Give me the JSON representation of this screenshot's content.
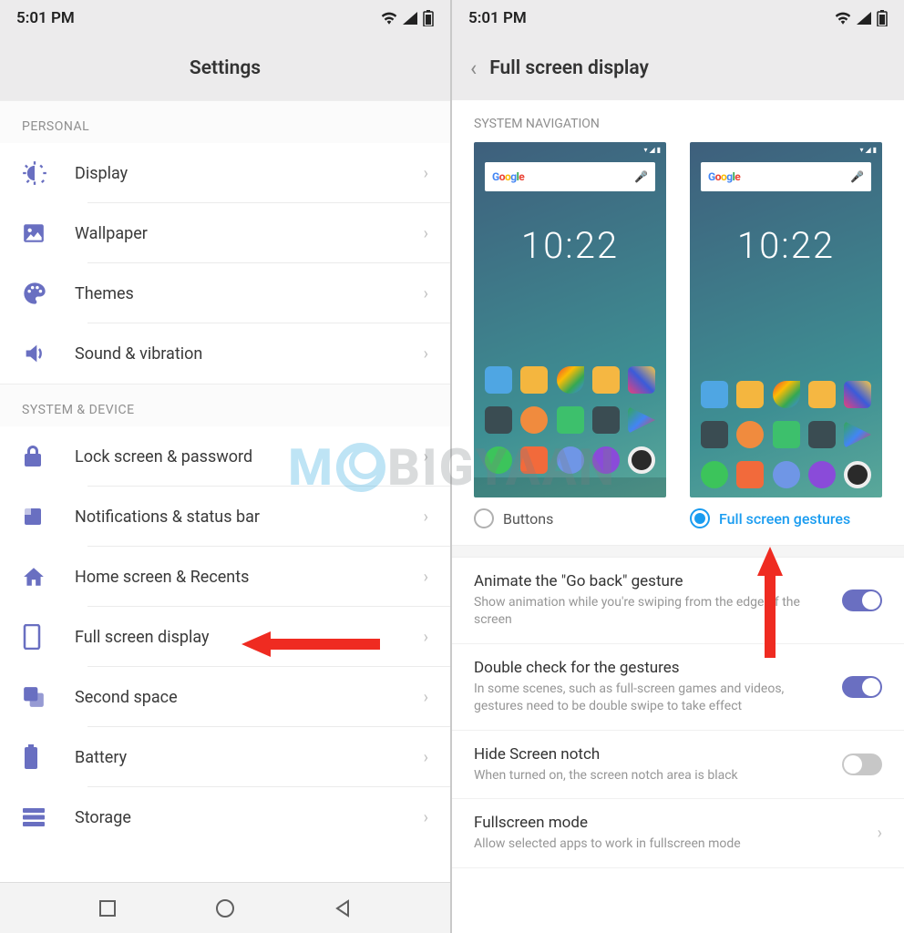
{
  "left": {
    "status_time": "5:01 PM",
    "header_title": "Settings",
    "sections": {
      "personal": {
        "label": "PERSONAL",
        "items": [
          {
            "label": "Display"
          },
          {
            "label": "Wallpaper"
          },
          {
            "label": "Themes"
          },
          {
            "label": "Sound & vibration"
          }
        ]
      },
      "system": {
        "label": "SYSTEM & DEVICE",
        "items": [
          {
            "label": "Lock screen & password"
          },
          {
            "label": "Notifications & status bar"
          },
          {
            "label": "Home screen & Recents"
          },
          {
            "label": "Full screen display"
          },
          {
            "label": "Second space"
          },
          {
            "label": "Battery"
          },
          {
            "label": "Storage"
          }
        ]
      }
    }
  },
  "right": {
    "status_time": "5:01 PM",
    "header_title": "Full screen display",
    "section_label": "SYSTEM NAVIGATION",
    "preview_time": "10:22",
    "preview_search": "Google",
    "options": {
      "buttons": {
        "label": "Buttons",
        "selected": false
      },
      "gestures": {
        "label": "Full screen gestures",
        "selected": true
      }
    },
    "settings": [
      {
        "title": "Animate the \"Go back\" gesture",
        "sub": "Show animation while you're swiping from the edge of the screen",
        "on": true,
        "type": "toggle"
      },
      {
        "title": "Double check for the gestures",
        "sub": "In some scenes, such as full-screen games and videos, gestures need to be double swipe to take effect",
        "on": true,
        "type": "toggle"
      },
      {
        "title": "Hide Screen notch",
        "sub": "When turned on, the screen notch area is black",
        "on": false,
        "type": "toggle"
      },
      {
        "title": "Fullscreen mode",
        "sub": "Allow selected apps to work in fullscreen mode",
        "type": "chevron"
      }
    ]
  },
  "watermark": {
    "m": "M",
    "rest": "BIGYAAN"
  }
}
